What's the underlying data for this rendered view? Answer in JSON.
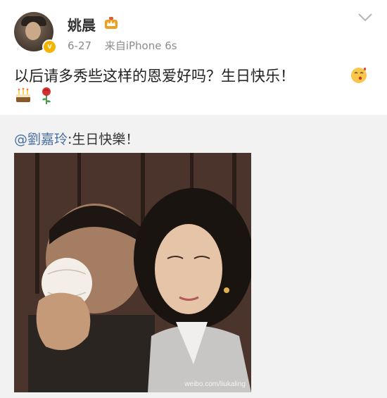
{
  "post": {
    "username": "姚晨",
    "verified_badge": "v",
    "date": "6-27",
    "source": "来自iPhone 6s",
    "content": "以后请多秀些这样的恩爱好吗？生日快乐！",
    "icons": [
      "crown-icon",
      "chevron-down-icon",
      "kiss-emoji-icon",
      "cake-emoji-icon",
      "rose-emoji-icon"
    ]
  },
  "repost": {
    "mention": "@劉嘉玲",
    "text": ":生日快樂！",
    "photo_watermark": "weibo.com/liukaling"
  },
  "colors": {
    "mention": "#4a6fa5",
    "verified": "#f5b400",
    "repost_bg": "#f2f2f2"
  }
}
